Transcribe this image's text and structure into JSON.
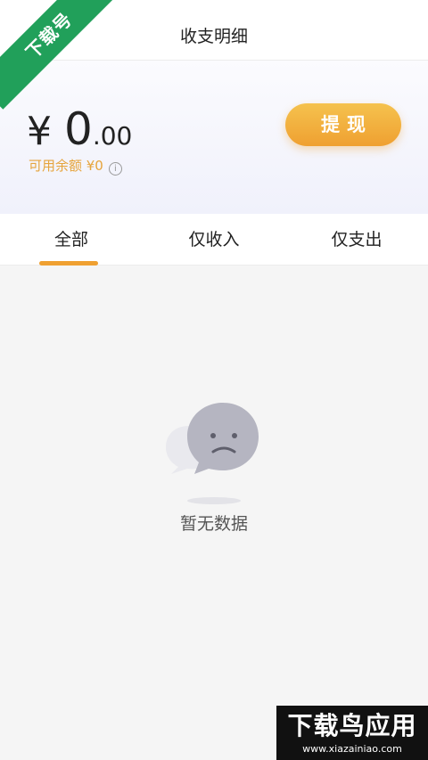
{
  "header": {
    "title": "收支明细"
  },
  "corner_badge": {
    "text": "下载号"
  },
  "balance": {
    "currency_symbol": "¥",
    "amount_integer": "0",
    "amount_decimal": ".00",
    "available_label": "可用余额 ¥0",
    "info_icon": "info-icon",
    "info_glyph": "i",
    "withdraw_label": "提现"
  },
  "tabs": [
    {
      "label": "全部",
      "active": true
    },
    {
      "label": "仅收入",
      "active": false
    },
    {
      "label": "仅支出",
      "active": false
    }
  ],
  "empty_state": {
    "icon": "sad-face-chat-bubble-icon",
    "text": "暂无数据"
  },
  "watermark": {
    "title": "下载鸟应用",
    "url": "www.xiazainiao.com"
  },
  "colors": {
    "accent": "#efa031",
    "available_text": "#e6a43c",
    "badge_green": "#21a05a"
  }
}
